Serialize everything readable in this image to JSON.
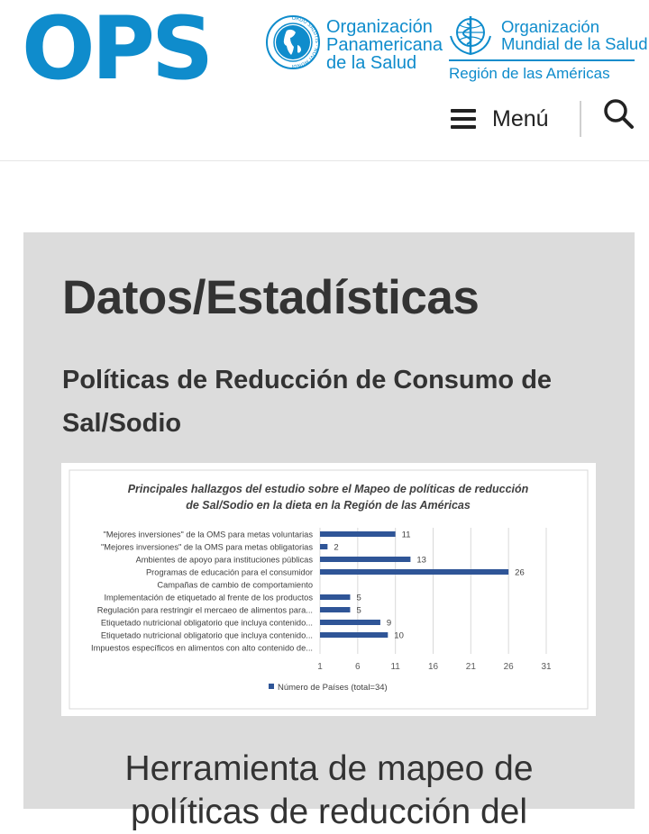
{
  "header": {
    "ops_logo": "OPS",
    "globe_ring_text": "ORDO SALUTIS · NOVI MUNDI",
    "paho_name": [
      "Organización",
      "Panamericana",
      "de la Salud"
    ],
    "who_name": [
      "Organización",
      "Mundial de la Salud"
    ],
    "region": "Región de las Américas",
    "menu_label": "Menú",
    "brand_color": "#0f8ccc"
  },
  "page": {
    "title": "Datos/Estadísticas",
    "subtitle": "Políticas de Reducción de Consumo de Sal/Sodio",
    "next_heading": [
      "Herramienta de mapeo de",
      "políticas de reducción del"
    ]
  },
  "chart_data": {
    "type": "bar",
    "orientation": "horizontal",
    "title": "Principales hallazgos del estudio sobre el Mapeo de políticas de reducción de Sal/Sodio en la dieta en la Región de las Américas",
    "title_lines": [
      "Principales hallazgos del estudio sobre el Mapeo de políticas de reducción",
      "de Sal/Sodio en la dieta en la Región de las Américas"
    ],
    "categories": [
      "\"Mejores inversiones\" de la OMS para metas voluntarias",
      "\"Mejores inversiones\" de la OMS para metas obligatorias",
      "Ambientes de apoyo para instituciones públicas",
      "Programas de educación para el consumidor",
      "Campañas de cambio de comportamiento",
      "Implementación de etiquetado al frente de los productos",
      "Regulación para restringir el mercaeo de alimentos para...",
      "Etiquetado nutricional obligatorio que incluya contenido...",
      "Etiquetado nutricional obligatorio que incluya contenido...",
      "Impuestos específicos en alimentos con alto contenido de..."
    ],
    "series": [
      {
        "name": "Número de Países (total=34)",
        "values": [
          11,
          2,
          13,
          26,
          null,
          5,
          5,
          9,
          10,
          null
        ],
        "color": "#2f5597"
      }
    ],
    "data_labels": [
      "11",
      "2",
      "13",
      "26",
      "",
      "5",
      "5",
      "9",
      "10",
      ""
    ],
    "xlim": [
      1,
      31
    ],
    "xticks": [
      "1",
      "6",
      "11",
      "16",
      "21",
      "26",
      "31"
    ],
    "grid": true,
    "legend": "bottom"
  }
}
